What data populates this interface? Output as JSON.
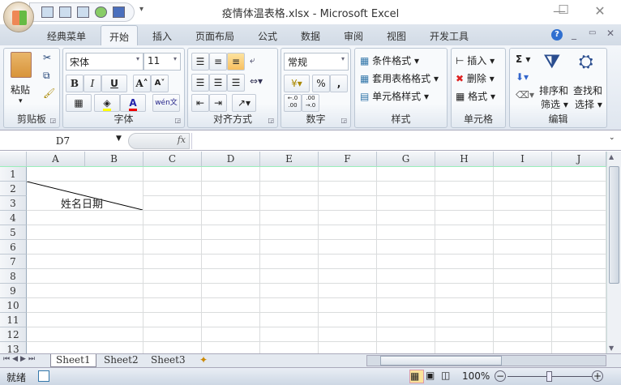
{
  "window": {
    "title": "疫情体温表格.xlsx - Microsoft Excel",
    "minimize": "—",
    "maximize": "☐",
    "close": "✕"
  },
  "tabs": [
    "经典菜单",
    "开始",
    "插入",
    "页面布局",
    "公式",
    "数据",
    "审阅",
    "视图",
    "开发工具"
  ],
  "active_tab": "开始",
  "ribbon": {
    "clipboard": {
      "label": "剪贴板",
      "paste": "粘贴"
    },
    "font": {
      "label": "字体",
      "font_name": "宋体",
      "font_size": "11",
      "bold": "B",
      "italic": "I",
      "underline": "U",
      "grow": "A˄",
      "shrink": "A˅",
      "fill_color": "#ffff00",
      "font_color": "#e00000",
      "phonetic": "wén文"
    },
    "alignment": {
      "label": "对齐方式"
    },
    "number": {
      "label": "数字",
      "format": "常规",
      "percent": "%",
      "comma": ",",
      "inc_dec": "←.0 .00",
      "dec_dec": ".00 →.0"
    },
    "styles": {
      "label": "样式",
      "items": [
        "条件格式 ▾",
        "套用表格格式 ▾",
        "单元格样式 ▾"
      ]
    },
    "cells": {
      "label": "单元格",
      "items": [
        "插入 ▾",
        "删除 ▾",
        "格式 ▾"
      ]
    },
    "editing": {
      "label": "编辑",
      "sum": "Σ ▾",
      "sort": "排序和",
      "sort2": "筛选 ▾",
      "find": "查找和",
      "find2": "选择 ▾"
    }
  },
  "formula_bar": {
    "name_box": "D7",
    "fx": "fx",
    "value": ""
  },
  "columns": [
    "A",
    "B",
    "C",
    "D",
    "E",
    "F",
    "G",
    "H",
    "I",
    "J"
  ],
  "rows": [
    "1",
    "2",
    "3",
    "4",
    "5",
    "6",
    "7",
    "8",
    "9",
    "10",
    "11",
    "12",
    "13"
  ],
  "cells": {
    "A2_B3": "姓名日期"
  },
  "sheets": [
    "Sheet1",
    "Sheet2",
    "Sheet3"
  ],
  "active_sheet": "Sheet1",
  "status": {
    "ready": "就绪",
    "zoom": "100%",
    "zoom_minus": "−",
    "zoom_plus": "+"
  }
}
